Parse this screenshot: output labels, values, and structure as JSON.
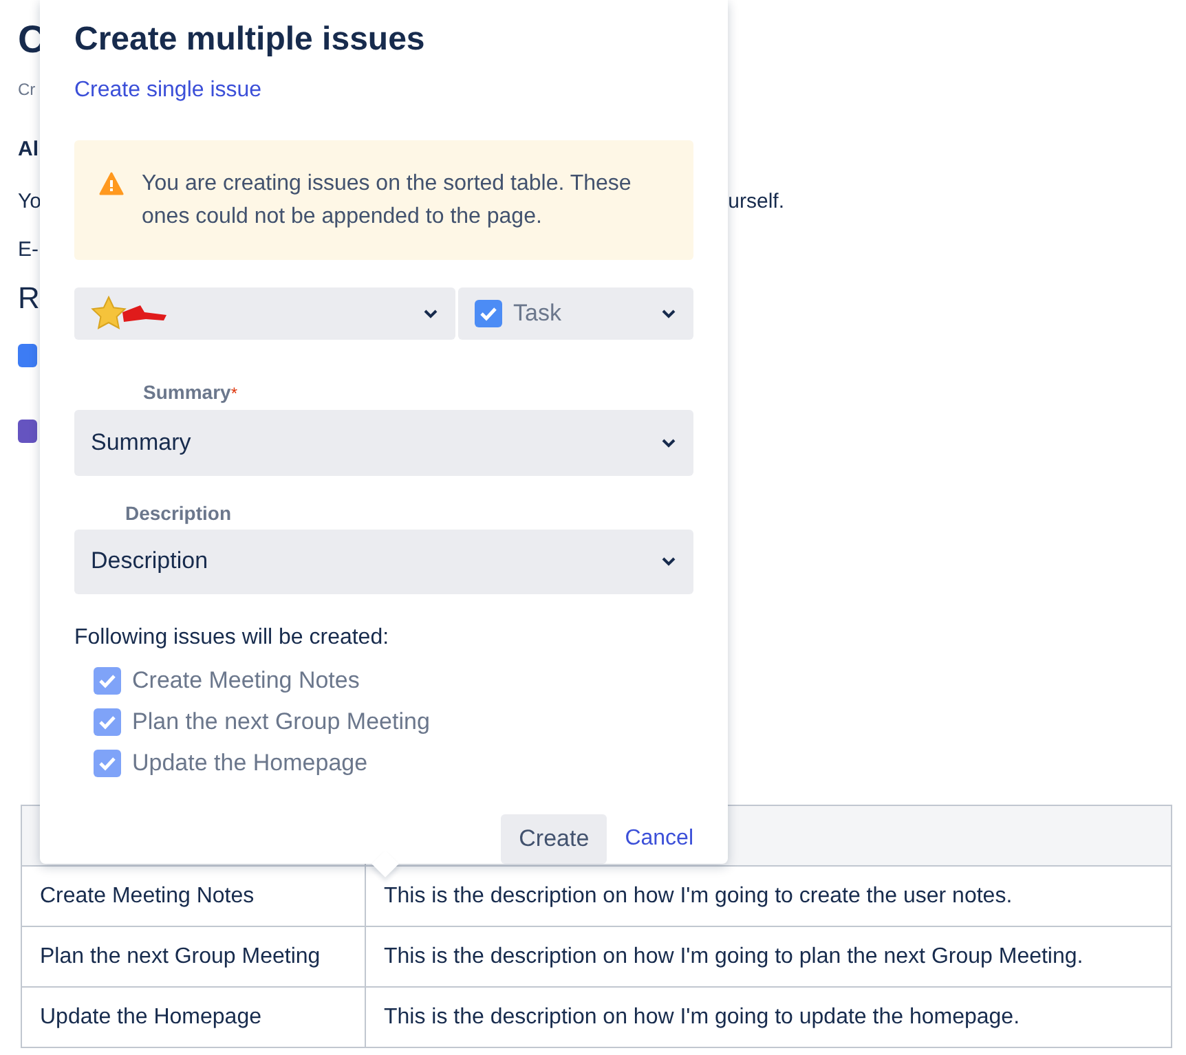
{
  "page": {
    "heading_fragment": "C",
    "subtitle_fragment": "Cr",
    "bold_fragment": "Al",
    "line_start_fragment": "Yo",
    "line_end_fragment": "urself.",
    "email_fragment": "E-",
    "section_fragment": "R"
  },
  "dialog": {
    "title": "Create multiple issues",
    "switch_link": "Create single issue",
    "warning": "You are creating issues on the sorted table. These ones could not be appended to the page.",
    "type_select": {
      "value": "Task",
      "checked": true
    },
    "fields": [
      {
        "label": "Summary",
        "required_mark": "*",
        "value": "Summary"
      },
      {
        "label": "Description",
        "value": "Description"
      }
    ],
    "issues_heading": "Following issues will be created:",
    "issues": [
      {
        "label": "Create Meeting Notes",
        "checked": true
      },
      {
        "label": "Plan the next Group Meeting",
        "checked": true
      },
      {
        "label": "Update the Homepage",
        "checked": true
      }
    ],
    "create_button": "Create",
    "cancel_link": "Cancel"
  },
  "table": {
    "rows": [
      [
        "Create Meeting Notes",
        "This is the description on how I'm going to create the user notes."
      ],
      [
        "Plan the next Group Meeting",
        "This is the description on how I'm going to plan the next Group Meeting."
      ],
      [
        "Update the Homepage",
        "This is the description on how I'm going to update the homepage."
      ]
    ]
  }
}
